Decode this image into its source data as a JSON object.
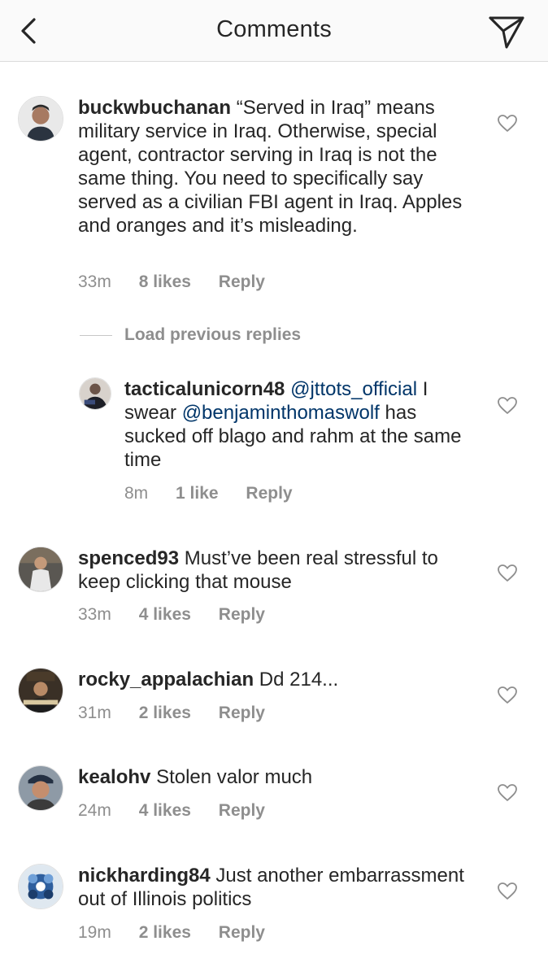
{
  "header": {
    "title": "Comments"
  },
  "load_previous": "Load previous replies",
  "comments": [
    {
      "username": "buckwbuchanan",
      "text": "“Served in Iraq” means military service in Iraq. Otherwise, special agent, contractor serving in Iraq is not the same thing.  You need to specifically say served as a civilian FBI agent in Iraq. Apples and oranges and it’s misleading.",
      "time": "33m",
      "likes": "8 likes",
      "reply": "Reply"
    },
    {
      "username": "tacticalunicorn48",
      "mention1": "@jttots_official",
      "text_a": " I swear ",
      "mention2": "@benjaminthomaswolf",
      "text_b": " has sucked off blago and rahm at the same time",
      "time": "8m",
      "likes": "1 like",
      "reply": "Reply"
    },
    {
      "username": "spenced93",
      "text": "Must’ve been real stressful to keep clicking that mouse",
      "time": "33m",
      "likes": "4 likes",
      "reply": "Reply"
    },
    {
      "username": "rocky_appalachian",
      "text": "Dd 214...",
      "time": "31m",
      "likes": "2 likes",
      "reply": "Reply"
    },
    {
      "username": "kealohv",
      "text": "Stolen valor much",
      "time": "24m",
      "likes": "4 likes",
      "reply": "Reply"
    },
    {
      "username": "nickharding84",
      "text": "Just another embarrassment out of Illinois politics",
      "time": "19m",
      "likes": "2 likes",
      "reply": "Reply"
    }
  ],
  "icons": {
    "back": "chevron-left-icon",
    "send": "paper-plane-icon",
    "like": "heart-outline-icon"
  }
}
